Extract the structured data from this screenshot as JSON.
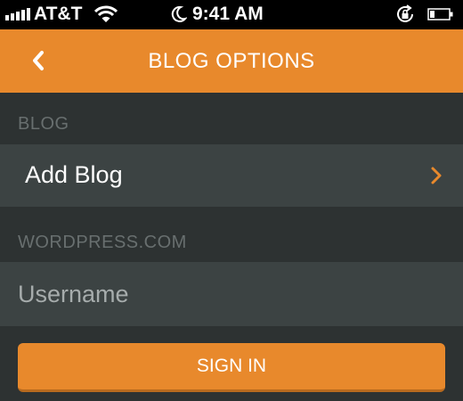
{
  "status_bar": {
    "carrier": "AT&T",
    "time": "9:41 AM",
    "icons": [
      "signal-icon",
      "wifi-icon",
      "moon-icon",
      "rotation-lock-icon",
      "battery-icon"
    ]
  },
  "nav": {
    "title": "BLOG OPTIONS",
    "back_icon": "chevron-left-icon"
  },
  "sections": {
    "blog": {
      "header": "BLOG",
      "item_label": "Add Blog",
      "item_icon": "chevron-right-icon"
    },
    "wordpress": {
      "header": "WORDPRESS.COM",
      "username_placeholder": "Username",
      "username_value": ""
    }
  },
  "sign_in_label": "SIGN IN",
  "colors": {
    "accent": "#e8892c",
    "background": "#2d3232",
    "row": "#3c4343",
    "section_header": "#686f6f"
  }
}
